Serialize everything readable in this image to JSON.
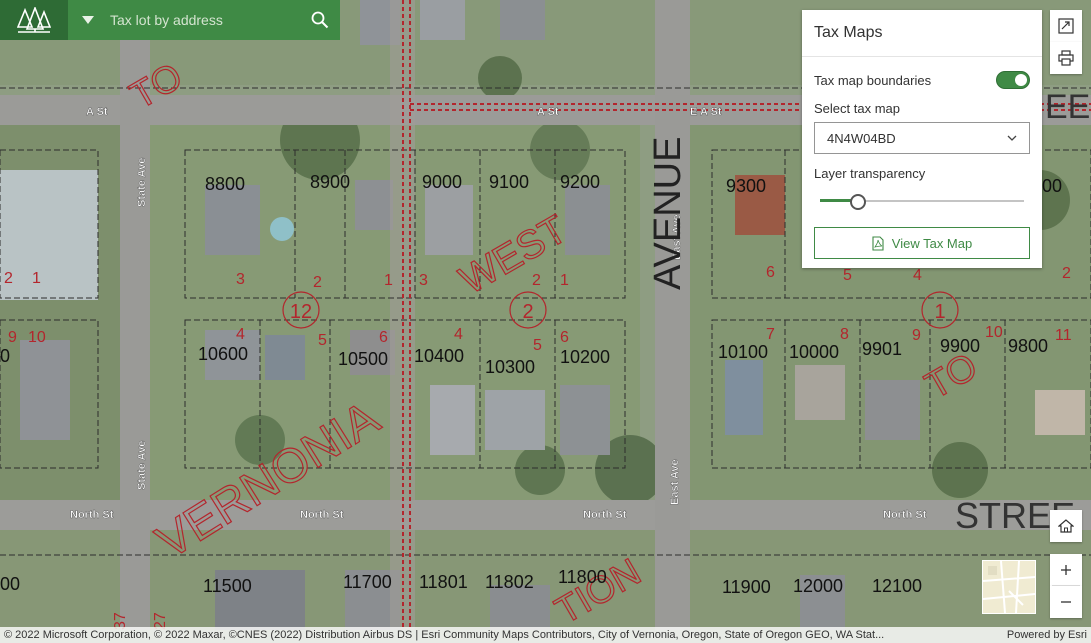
{
  "search": {
    "placeholder": "Tax lot by address"
  },
  "panel": {
    "title": "Tax Maps",
    "toggle_label": "Tax map boundaries",
    "toggle_on": true,
    "select_label": "Select tax map",
    "select_value": "4N4W04BD",
    "slider_label": "Layer transparency",
    "slider_value": 0.18,
    "button_label": "View Tax Map"
  },
  "map": {
    "streets": [
      "A St",
      "A St",
      "E A St",
      "North St",
      "North St",
      "North St",
      "North St",
      "State Ave",
      "State Ave",
      "East Ave",
      "East Ave"
    ],
    "big_labels": [
      "AVENUE",
      "WEST",
      "VERNONIA",
      "TO",
      "TO",
      "STREE",
      "TION",
      "EET"
    ],
    "block_numbers": [
      "12",
      "2",
      "1"
    ],
    "lot_numbers": [
      "8800",
      "8900",
      "9000",
      "9100",
      "9200",
      "9300",
      "00",
      "10600",
      "10500",
      "10400",
      "10300",
      "10200",
      "10100",
      "10000",
      "9901",
      "9900",
      "9800",
      "11500",
      "11700",
      "11801",
      "11802",
      "11800",
      "11900",
      "12000",
      "12100",
      "00",
      "0"
    ],
    "lot_small_numbers": [
      "2",
      "1",
      "3",
      "2",
      "1",
      "3",
      "2",
      "1",
      "6",
      "5",
      "4",
      "2",
      "9",
      "10",
      "4",
      "5",
      "6",
      "4",
      "5",
      "6",
      "7",
      "8",
      "9",
      "10",
      "11",
      "37",
      "27"
    ]
  },
  "attribution": {
    "left": "© 2022 Microsoft Corporation, © 2022 Maxar, ©CNES (2022) Distribution Airbus DS | Esri Community Maps Contributors, City of Vernonia, Oregon, State of Oregon GEO, WA Stat...",
    "right": "Powered by Esri"
  },
  "colors": {
    "brand_dark": "#2e6b35",
    "brand": "#3f8a45",
    "taxmap_red": "#b3262d"
  }
}
